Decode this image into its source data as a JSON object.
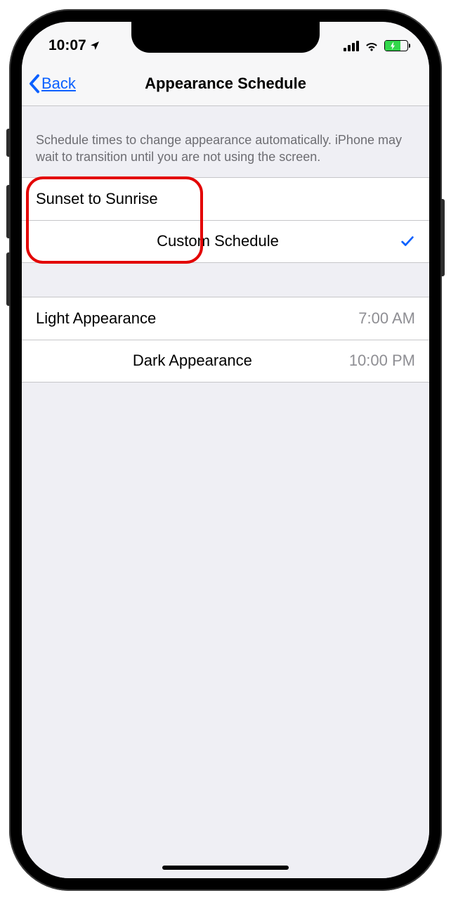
{
  "status": {
    "time": "10:07",
    "location_icon": "location-arrow-icon"
  },
  "nav": {
    "back_label": "Back",
    "title": "Appearance Schedule"
  },
  "description": "Schedule times to change appearance automatically. iPhone may wait to transition until you are not using the screen.",
  "schedule_options": [
    {
      "label": "Sunset to Sunrise",
      "selected": false
    },
    {
      "label": "Custom Schedule",
      "selected": true
    }
  ],
  "time_settings": [
    {
      "label": "Light Appearance",
      "value": "7:00 AM"
    },
    {
      "label": "Dark Appearance",
      "value": "10:00 PM"
    }
  ]
}
